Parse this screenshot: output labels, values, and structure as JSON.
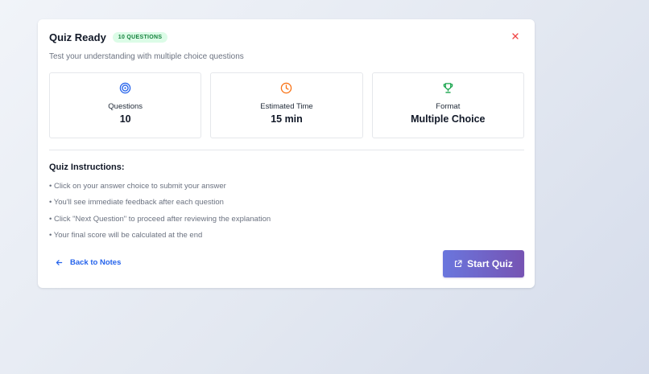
{
  "header": {
    "title": "Quiz Ready",
    "badge": "10 QUESTIONS",
    "subtitle": "Test your understanding with multiple choice questions",
    "close_icon": "close-icon"
  },
  "stats": [
    {
      "icon": "target-icon",
      "label": "Questions",
      "value": "10",
      "color": "#2563eb"
    },
    {
      "icon": "clock-icon",
      "label": "Estimated Time",
      "value": "15 min",
      "color": "#f97316"
    },
    {
      "icon": "trophy-icon",
      "label": "Format",
      "value": "Multiple Choice",
      "color": "#16a34a"
    }
  ],
  "instructions": {
    "title": "Quiz Instructions:",
    "items": [
      "• Click on your answer choice to submit your answer",
      "• You'll see immediate feedback after each question",
      "• Click \"Next Question\" to proceed after reviewing the explanation",
      "• Your final score will be calculated at the end"
    ]
  },
  "footer": {
    "back_label": "Back to Notes",
    "back_icon": "arrow-left-icon",
    "start_label": "Start Quiz",
    "start_icon": "external-link-icon"
  },
  "colors": {
    "accent_blue": "#2563eb",
    "badge_bg": "#dcfce7",
    "badge_text": "#15803d",
    "close_red": "#ef4444",
    "button_gradient_start": "#6a76dd",
    "button_gradient_end": "#7653b3"
  }
}
